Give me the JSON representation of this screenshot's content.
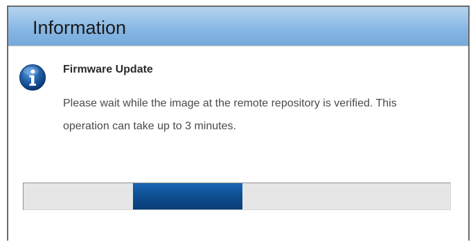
{
  "dialog": {
    "title": "Information",
    "icon": "info-icon",
    "heading": "Firmware Update",
    "message": "Please wait while the image at the remote repository is verified. This operation can take up to 3 minutes.",
    "progress": {
      "indeterminate": true,
      "segment_start_fraction": 0.257,
      "segment_end_fraction": 0.513
    }
  },
  "colors": {
    "titlebar": "#86b6e3",
    "progress_fill": "#0f4f93",
    "progress_track": "#e6e6e6",
    "icon_blue": "#1f5fa8"
  }
}
